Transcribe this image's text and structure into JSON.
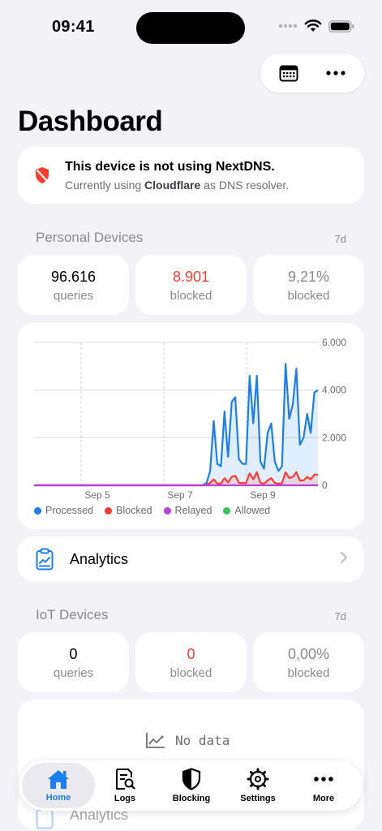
{
  "status": {
    "time": "09:41"
  },
  "header": {
    "title": "Dashboard"
  },
  "warning": {
    "title": "This device is not using NextDNS.",
    "subtitle_prefix": "Currently using ",
    "resolver": "Cloudflare",
    "subtitle_suffix": " as DNS resolver."
  },
  "personal": {
    "title": "Personal Devices",
    "range": "7d",
    "stats": [
      {
        "value": "96.616",
        "label": "queries"
      },
      {
        "value": "8.901",
        "label": "blocked"
      },
      {
        "value": "9,21%",
        "label": "blocked"
      }
    ],
    "analytics_label": "Analytics"
  },
  "chart_data": {
    "type": "area",
    "x_labels": [
      "Sep 5",
      "Sep 7",
      "Sep 9"
    ],
    "y_ticks": [
      "6.000",
      "4.000",
      "2.000",
      "0"
    ],
    "ylim": [
      0,
      6000
    ],
    "legend": [
      {
        "name": "Processed",
        "color": "#1a7ef0"
      },
      {
        "name": "Blocked",
        "color": "#ff3b30"
      },
      {
        "name": "Relayed",
        "color": "#bf3fdc"
      },
      {
        "name": "Allowed",
        "color": "#34c759"
      }
    ],
    "series": [
      {
        "name": "Processed",
        "color": "#1a7ef0",
        "values": [
          0,
          0,
          0,
          0,
          0,
          0,
          0,
          0,
          0,
          0,
          0,
          0,
          0,
          0,
          0,
          0,
          0,
          0,
          0,
          0,
          0,
          0,
          0,
          0,
          0,
          0,
          0,
          0,
          0,
          0,
          0,
          0,
          0,
          0,
          0,
          0,
          0,
          0,
          0,
          0,
          0,
          0,
          0,
          0,
          0,
          0,
          0,
          0,
          100,
          600,
          2700,
          900,
          800,
          3100,
          1200,
          3500,
          3700,
          1100,
          900,
          900,
          4600,
          2600,
          4600,
          1000,
          700,
          2200,
          2600,
          1000,
          600,
          800,
          5100,
          2800,
          3400,
          4900,
          1700,
          2000,
          3000,
          2200,
          3900,
          4000
        ]
      },
      {
        "name": "Blocked",
        "color": "#ff3b30",
        "values": [
          0,
          0,
          0,
          0,
          0,
          0,
          0,
          0,
          0,
          0,
          0,
          0,
          0,
          0,
          0,
          0,
          0,
          0,
          0,
          0,
          0,
          0,
          0,
          0,
          0,
          0,
          0,
          0,
          0,
          0,
          0,
          0,
          0,
          0,
          0,
          0,
          0,
          0,
          0,
          0,
          0,
          0,
          0,
          0,
          0,
          0,
          0,
          0,
          20,
          100,
          250,
          80,
          70,
          300,
          120,
          350,
          400,
          110,
          90,
          100,
          500,
          250,
          550,
          100,
          70,
          200,
          300,
          100,
          60,
          90,
          550,
          300,
          350,
          550,
          200,
          200,
          350,
          250,
          450,
          450
        ]
      },
      {
        "name": "Relayed",
        "color": "#bf3fdc",
        "values": [
          0,
          0,
          0,
          0,
          0,
          0,
          0,
          0,
          0,
          0,
          0,
          0,
          0,
          0,
          0,
          0,
          0,
          0,
          0,
          0,
          0,
          0,
          0,
          0,
          0,
          0,
          0,
          0,
          0,
          0,
          0,
          0,
          0,
          0,
          0,
          0,
          0,
          0,
          0,
          0,
          0,
          0,
          0,
          0,
          0,
          0,
          0,
          0,
          0,
          0,
          0,
          0,
          0,
          0,
          0,
          0,
          0,
          0,
          0,
          0,
          0,
          0,
          0,
          0,
          0,
          0,
          0,
          0,
          0,
          0,
          0,
          0,
          0,
          0,
          0,
          0,
          0,
          0,
          0,
          0
        ]
      }
    ]
  },
  "iot": {
    "title": "IoT Devices",
    "range": "7d",
    "stats": [
      {
        "value": "0",
        "label": "queries"
      },
      {
        "value": "0",
        "label": "blocked"
      },
      {
        "value": "0,00%",
        "label": "blocked"
      }
    ],
    "no_data": "No data",
    "analytics_label": "Analytics"
  },
  "tabs": [
    {
      "label": "Home",
      "icon": "house-icon",
      "active": true
    },
    {
      "label": "Logs",
      "icon": "logs-icon",
      "active": false
    },
    {
      "label": "Blocking",
      "icon": "shield-icon",
      "active": false
    },
    {
      "label": "Settings",
      "icon": "gear-icon",
      "active": false
    },
    {
      "label": "More",
      "icon": "ellipsis-icon",
      "active": false
    }
  ],
  "colors": {
    "accent": "#1a7ef0",
    "danger": "#ff3b30",
    "background": "#f2f2f7"
  }
}
